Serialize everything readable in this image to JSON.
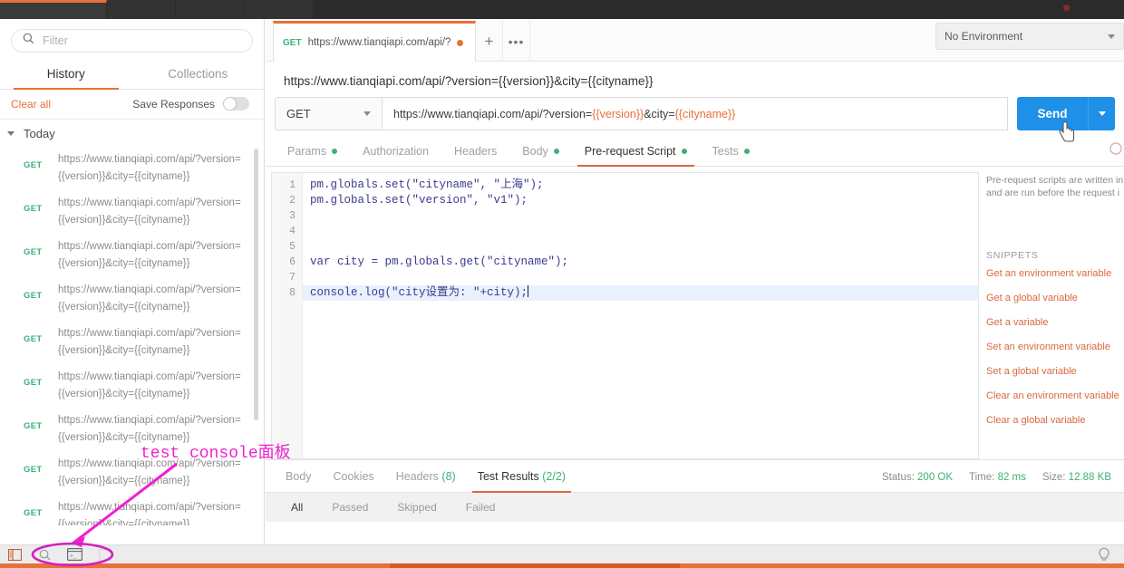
{
  "window": {
    "title_bar": ""
  },
  "sidebar": {
    "search": {
      "placeholder": "Filter",
      "value": "",
      "icon": "search-icon"
    },
    "tabs": [
      {
        "label": "History",
        "active": true
      },
      {
        "label": "Collections",
        "active": false
      }
    ],
    "actions": {
      "clear_all": "Clear all",
      "save_responses": "Save Responses",
      "toggle_state": "off"
    },
    "group_label": "Today",
    "history": [
      {
        "method": "GET",
        "url": "https://www.tianqiapi.com/api/?version={{version}}&city={{cityname}}"
      },
      {
        "method": "GET",
        "url": "https://www.tianqiapi.com/api/?version={{version}}&city={{cityname}}"
      },
      {
        "method": "GET",
        "url": "https://www.tianqiapi.com/api/?version={{version}}&city={{cityname}}"
      },
      {
        "method": "GET",
        "url": "https://www.tianqiapi.com/api/?version={{version}}&city={{cityname}}"
      },
      {
        "method": "GET",
        "url": "https://www.tianqiapi.com/api/?version={{version}}&city={{cityname}}"
      },
      {
        "method": "GET",
        "url": "https://www.tianqiapi.com/api/?version={{version}}&city={{cityname}}"
      },
      {
        "method": "GET",
        "url": "https://www.tianqiapi.com/api/?version={{version}}&city={{cityname}}"
      },
      {
        "method": "GET",
        "url": "https://www.tianqiapi.com/api/?version={{version}}&city={{cityname}}"
      },
      {
        "method": "GET",
        "url": "https://www.tianqiapi.com/api/?version={{version}}&city={{cityname}}"
      }
    ]
  },
  "topbar": {
    "request_tab": {
      "method": "GET",
      "title": "https://www.tianqiapi.com/api/?",
      "unsaved": true
    },
    "new_tab_label": "+",
    "more_label": "•••",
    "environment": {
      "selected": "No Environment"
    }
  },
  "request": {
    "url_title": "https://www.tianqiapi.com/api/?version={{version}}&city={{cityname}}",
    "method": "GET",
    "url_prefix": "https://www.tianqiapi.com/api/?version=",
    "url_var1": "{{version}}",
    "url_mid": "&city=",
    "url_var2": "{{cityname}}",
    "send_label": "Send",
    "tabs": [
      {
        "label": "Params",
        "dot": true,
        "active": false
      },
      {
        "label": "Authorization",
        "dot": false,
        "active": false
      },
      {
        "label": "Headers",
        "dot": false,
        "active": false
      },
      {
        "label": "Body",
        "dot": true,
        "active": false
      },
      {
        "label": "Pre-request Script",
        "dot": true,
        "active": true
      },
      {
        "label": "Tests",
        "dot": true,
        "active": false
      }
    ]
  },
  "editor": {
    "line_numbers": [
      "1",
      "2",
      "3",
      "4",
      "5",
      "6",
      "7",
      "8"
    ],
    "lines": [
      "pm.globals.set(\"cityname\", \"上海\");",
      "pm.globals.set(\"version\", \"v1\");",
      "",
      "",
      "",
      "var city = pm.globals.get(\"cityname\");",
      "",
      "console.log(\"city设置为: \"+city);"
    ],
    "active_line": 8
  },
  "docs": {
    "description_line1": "Pre-request scripts are written in",
    "description_line2": "and are run before the request i",
    "snippets_title": "SNIPPETS",
    "snippets": [
      "Get an environment variable",
      "Get a global variable",
      "Get a variable",
      "Set an environment variable",
      "Set a global variable",
      "Clear an environment variable",
      "Clear a global variable"
    ]
  },
  "response": {
    "tabs": [
      {
        "label": "Body",
        "count": "",
        "active": false
      },
      {
        "label": "Cookies",
        "count": "",
        "active": false
      },
      {
        "label": "Headers",
        "count": "(8)",
        "active": false
      },
      {
        "label": "Test Results",
        "count": "(2/2)",
        "active": true
      }
    ],
    "meta": {
      "status_label": "Status:",
      "status_value": "200 OK",
      "time_label": "Time:",
      "time_value": "82 ms",
      "size_label": "Size:",
      "size_value": "12.88 KB"
    },
    "filters": [
      {
        "label": "All",
        "active": true
      },
      {
        "label": "Passed",
        "active": false
      },
      {
        "label": "Skipped",
        "active": false
      },
      {
        "label": "Failed",
        "active": false
      }
    ]
  },
  "statusbar": {
    "icons": [
      "sidebar-toggle-icon",
      "find-icon",
      "console-icon",
      "runner-icon"
    ],
    "right_icon": "lightbulb-icon"
  },
  "annotation": {
    "text": "test console面板",
    "color": "#f020d0"
  },
  "colors": {
    "accent_orange": "#e8703a",
    "send_blue": "#1e90e8",
    "method_green": "#3bb273",
    "annotation_magenta": "#f020d0"
  }
}
